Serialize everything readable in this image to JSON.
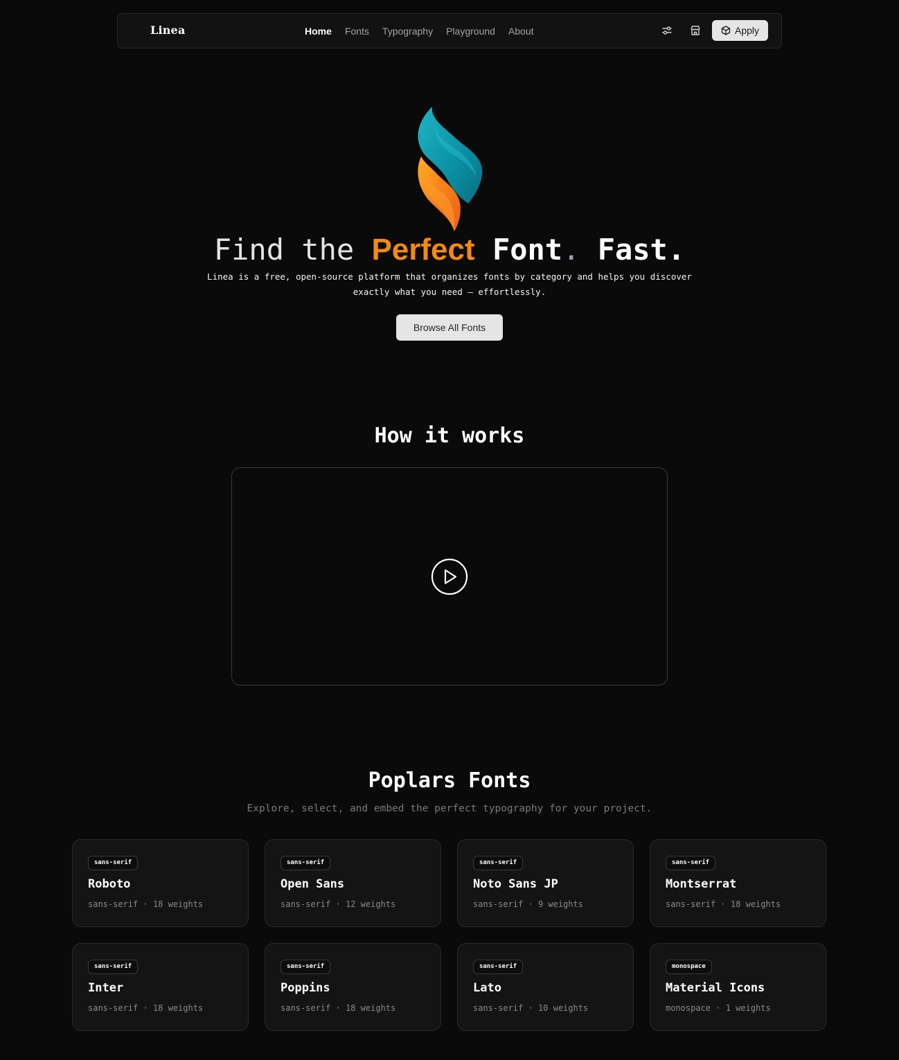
{
  "nav": {
    "brand": "Linea",
    "links": [
      "Home",
      "Fonts",
      "Typography",
      "Playground",
      "About"
    ],
    "active": "Home",
    "icons": [
      "sliders-icon",
      "store-icon"
    ],
    "apply_label": "Apply"
  },
  "hero": {
    "title_part1": "Find the",
    "title_accent": "Perfect",
    "title_part2": "Font",
    "title_dot": ".",
    "title_part3": "Fast.",
    "subtitle": "Linea is a free, open-source platform that organizes fonts by category and helps you discover exactly what you need — effortlessly.",
    "cta": "Browse All Fonts",
    "accent_color": "#f48a10"
  },
  "how": {
    "title": "How it works"
  },
  "popular": {
    "title": "Poplars Fonts",
    "subtitle": "Explore, select, and embed the perfect typography for your project.",
    "fonts": [
      {
        "tag": "sans-serif",
        "name": "Roboto",
        "category": "sans-serif",
        "weights": "18 weights"
      },
      {
        "tag": "sans-serif",
        "name": "Open Sans",
        "category": "sans-serif",
        "weights": "12 weights"
      },
      {
        "tag": "sans-serif",
        "name": "Noto Sans JP",
        "category": "sans-serif",
        "weights": "9 weights"
      },
      {
        "tag": "sans-serif",
        "name": "Montserrat",
        "category": "sans-serif",
        "weights": "18 weights"
      },
      {
        "tag": "sans-serif",
        "name": "Inter",
        "category": "sans-serif",
        "weights": "18 weights"
      },
      {
        "tag": "sans-serif",
        "name": "Poppins",
        "category": "sans-serif",
        "weights": "18 weights"
      },
      {
        "tag": "sans-serif",
        "name": "Lato",
        "category": "sans-serif",
        "weights": "10 weights"
      },
      {
        "tag": "monospace",
        "name": "Material Icons",
        "category": "monospace",
        "weights": "1 weights"
      }
    ]
  }
}
